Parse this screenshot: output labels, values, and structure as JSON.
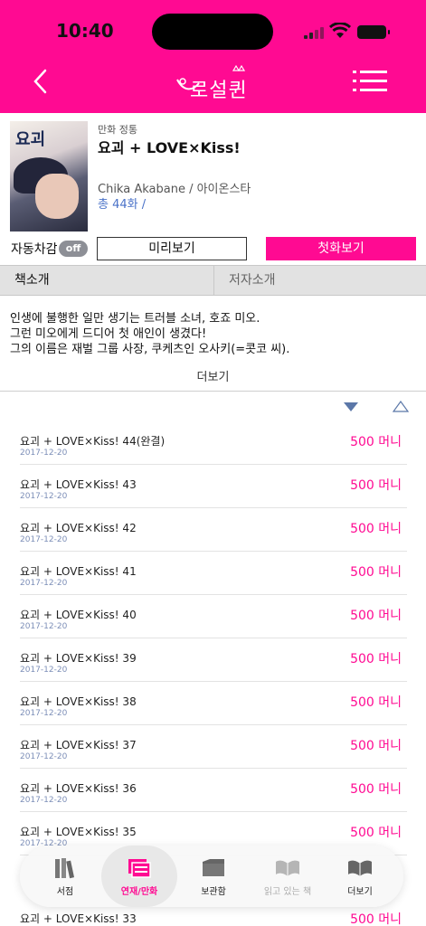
{
  "status_bar": {
    "time": "10:40"
  },
  "header": {
    "logo_text": "로설퀸",
    "brand_color": "#ff0a92"
  },
  "book": {
    "cover_text": "요괴",
    "genre": "만화 정통",
    "title": "요괴 + LOVE×Kiss!",
    "author": "Chika Akabane / 아이온스타",
    "episode_count": "총 44화 /"
  },
  "actions": {
    "autopay_label": "자동차감",
    "autopay_state": "off",
    "preview_label": "미리보기",
    "first_episode_label": "첫화보기"
  },
  "tabs": {
    "book_intro": "책소개",
    "author_intro": "저자소개"
  },
  "synopsis": {
    "lines": [
      "인생에 불행한 일만 생기는 트러블 소녀, 호죠 미오.",
      "그런 미오에게 드디어 첫 애인이 생겼다!",
      "그의 이름은 재벌 그룹 사장, 쿠케츠인 오사키(=콧코 씨)."
    ],
    "more_label": "더보기"
  },
  "episodes": [
    {
      "title": "요괴 + LOVE×Kiss! 44(완결)",
      "date": "2017-12-20",
      "price": "500 머니"
    },
    {
      "title": "요괴 + LOVE×Kiss! 43",
      "date": "2017-12-20",
      "price": "500 머니"
    },
    {
      "title": "요괴 + LOVE×Kiss! 42",
      "date": "2017-12-20",
      "price": "500 머니"
    },
    {
      "title": "요괴 + LOVE×Kiss! 41",
      "date": "2017-12-20",
      "price": "500 머니"
    },
    {
      "title": "요괴 + LOVE×Kiss! 40",
      "date": "2017-12-20",
      "price": "500 머니"
    },
    {
      "title": "요괴 + LOVE×Kiss! 39",
      "date": "2017-12-20",
      "price": "500 머니"
    },
    {
      "title": "요괴 + LOVE×Kiss! 38",
      "date": "2017-12-20",
      "price": "500 머니"
    },
    {
      "title": "요괴 + LOVE×Kiss! 37",
      "date": "2017-12-20",
      "price": "500 머니"
    },
    {
      "title": "요괴 + LOVE×Kiss! 36",
      "date": "2017-12-20",
      "price": "500 머니"
    },
    {
      "title": "요괴 + LOVE×Kiss! 35",
      "date": "2017-12-20",
      "price": "500 머니"
    },
    {
      "title": "요괴 + LOVE×Kiss! 33",
      "date": "",
      "price": "500 머니"
    }
  ],
  "bottom_nav": [
    {
      "label": "서점",
      "icon": "books-icon",
      "state": "normal"
    },
    {
      "label": "연재/만화",
      "icon": "serial-icon",
      "state": "active"
    },
    {
      "label": "보관함",
      "icon": "folder-icon",
      "state": "normal"
    },
    {
      "label": "읽고 있는 책",
      "icon": "open-book-icon",
      "state": "disabled"
    },
    {
      "label": "더보기",
      "icon": "open-book-icon",
      "state": "normal"
    }
  ]
}
